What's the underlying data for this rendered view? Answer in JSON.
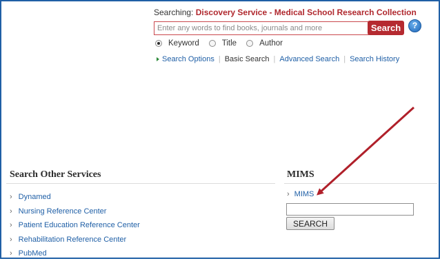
{
  "search": {
    "searching_prefix": "Searching:",
    "collection": "Discovery Service - Medical School Research Collection",
    "placeholder": "Enter any words to find books, journals and more",
    "button_label": "Search",
    "help_icon": "?",
    "modes": [
      {
        "label": "Keyword",
        "selected": true
      },
      {
        "label": "Title",
        "selected": false
      },
      {
        "label": "Author",
        "selected": false
      }
    ],
    "links": {
      "search_options": "Search Options",
      "basic_search": "Basic Search",
      "advanced_search": "Advanced Search",
      "search_history": "Search History"
    }
  },
  "other_services": {
    "title": "Search Other Services",
    "items": [
      "Dynamed",
      "Nursing Reference Center",
      "Patient Education Reference Center",
      "Rehabilitation Reference Center",
      "PubMed"
    ]
  },
  "mims": {
    "title": "MIMS",
    "link": "MIMS",
    "input_value": "",
    "button_label": "SEARCH"
  },
  "colors": {
    "accent_red": "#b52a30",
    "link_blue": "#1f5fa6",
    "frame_blue": "#1f5fa6",
    "annotation_arrow": "#b0202a"
  },
  "icons": {
    "help": "help-icon",
    "chevron": "chevron-right-icon",
    "triangle": "triangle-right-icon",
    "arrow": "annotation-arrow"
  }
}
